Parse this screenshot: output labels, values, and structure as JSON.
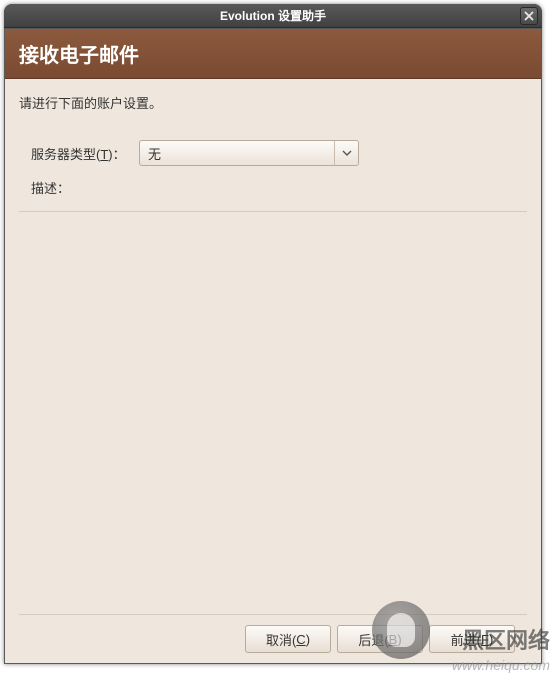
{
  "window": {
    "title": "Evolution 设置助手"
  },
  "header": {
    "title": "接收电子邮件"
  },
  "content": {
    "instruction": "请进行下面的账户设置。",
    "server_type_label_prefix": "服务器类型(",
    "server_type_accel": "T",
    "server_type_label_suffix": ")：",
    "server_type_value": "无",
    "description_label": "描述："
  },
  "buttons": {
    "cancel_prefix": "取消(",
    "cancel_accel": "C",
    "cancel_suffix": ")",
    "back_prefix": "后退(",
    "back_accel": "B",
    "back_suffix": ")",
    "forward_prefix": "前进(",
    "forward_accel": "F",
    "forward_suffix": ")"
  },
  "watermark": {
    "text": "黑区网络",
    "url": "www.heiqu.com"
  }
}
